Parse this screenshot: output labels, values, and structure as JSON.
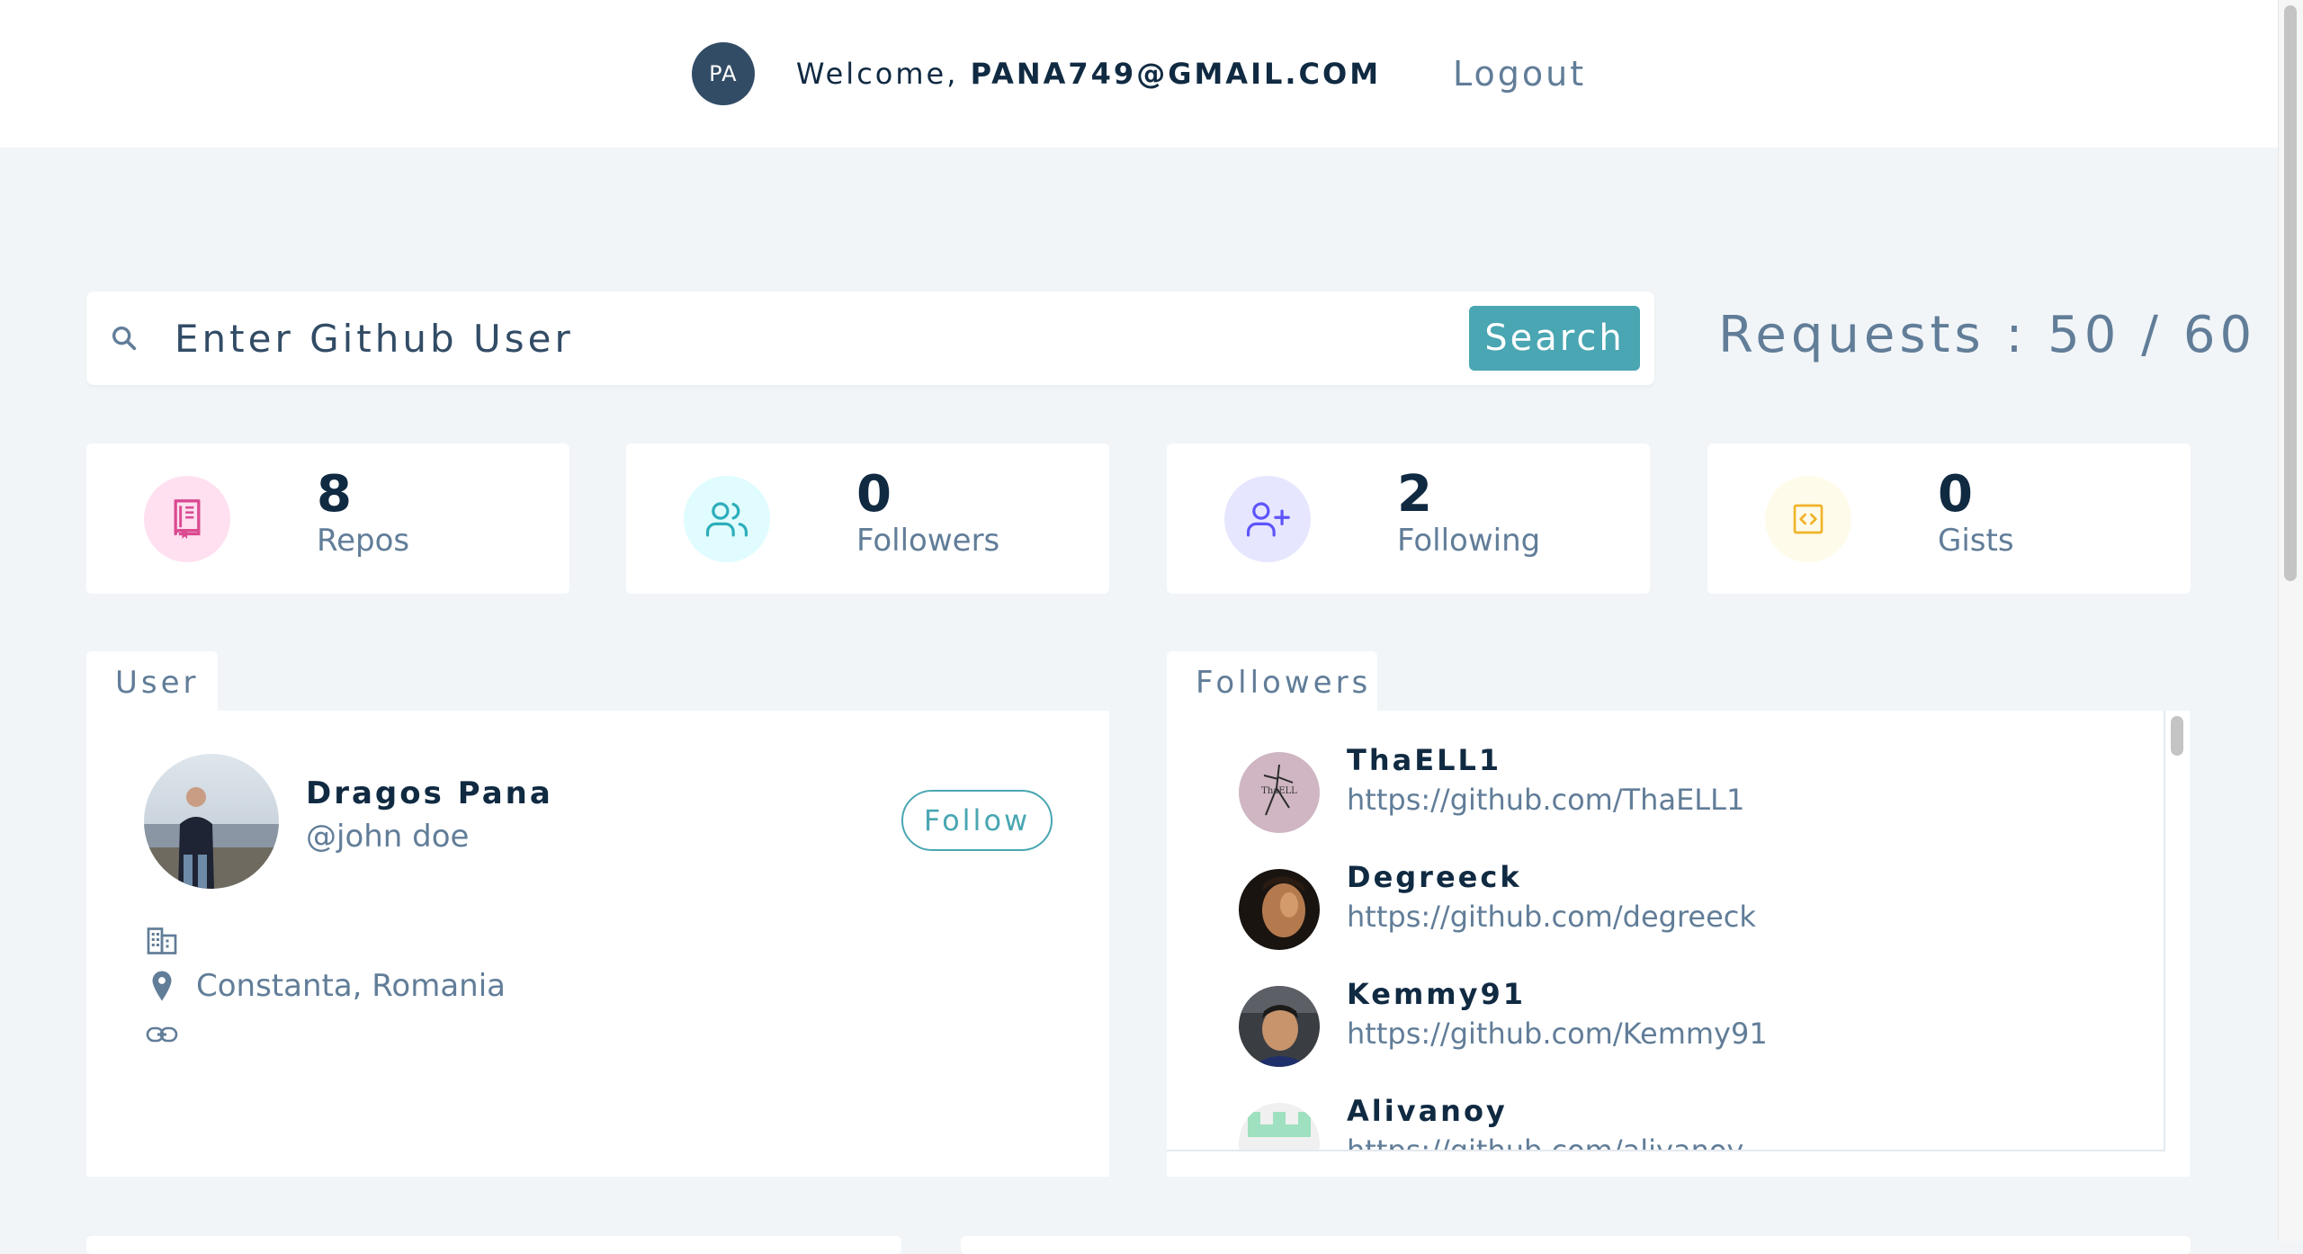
{
  "nav": {
    "avatar_initials": "PA",
    "welcome_prefix": "Welcome,",
    "user_email": "PANA749@GMAIL.COM",
    "logout_label": "Logout"
  },
  "search": {
    "placeholder": "Enter Github User",
    "button_label": "Search",
    "icon": "search-icon"
  },
  "requests": {
    "label": "Requests : 50 / 60"
  },
  "stats": [
    {
      "value": "8",
      "label": "Repos",
      "icon": "repo-book-icon",
      "color": "#da4a91",
      "bg": "#ffe0f0"
    },
    {
      "value": "0",
      "label": "Followers",
      "icon": "followers-icon",
      "color": "#2caeba",
      "bg": "#e0fcff"
    },
    {
      "value": "2",
      "label": "Following",
      "icon": "user-plus-icon",
      "color": "#5d55fa",
      "bg": "#e6e6ff"
    },
    {
      "value": "0",
      "label": "Gists",
      "icon": "code-icon",
      "color": "#f0b429",
      "bg": "#fffbea"
    }
  ],
  "user_panel": {
    "tab_label": "User",
    "name": "Dragos Pana",
    "login": "@john doe",
    "follow_label": "Follow",
    "company": "",
    "location": "Constanta, Romania",
    "blog": ""
  },
  "followers_panel": {
    "tab_label": "Followers",
    "items": [
      {
        "name": "ThaELL1",
        "url": "https://github.com/ThaELL1"
      },
      {
        "name": "Degreeck",
        "url": "https://github.com/degreeck"
      },
      {
        "name": "Kemmy91",
        "url": "https://github.com/Kemmy91"
      },
      {
        "name": "Alivanoy",
        "url": "https://github.com/alivanoy"
      }
    ]
  }
}
